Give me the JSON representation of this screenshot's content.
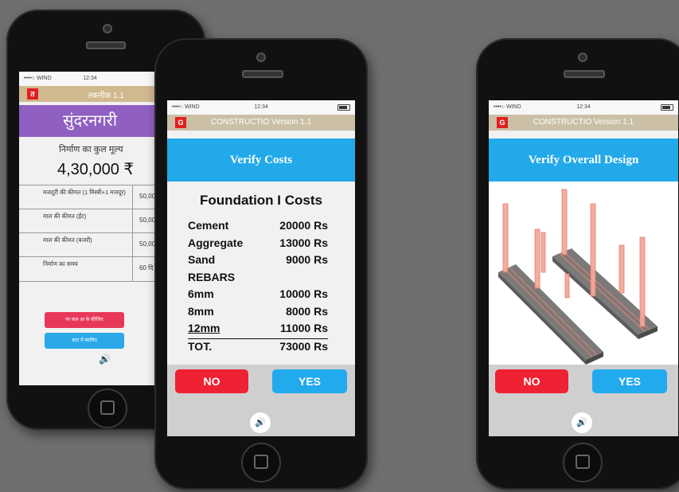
{
  "phone1": {
    "carrier": "••••○ WIND ",
    "time": "12:34",
    "logo_letter": "त",
    "version": "तकनीक 1.1",
    "title": "सुंदरनगरी",
    "total_label": "निर्माण का कुल मूल्य",
    "total_value": "4,30,000 ₹",
    "rows": [
      {
        "label": "मजदूरी की कीमत (1 मिस्त्री+1 मजदूर)",
        "value": "50,00"
      },
      {
        "label": "माल की कीमत (ईंट)",
        "value": "50,00"
      },
      {
        "label": "माल की कीमत (बजरी)",
        "value": "50,00"
      },
      {
        "label": "निर्माण का समय",
        "value": "60 दि"
      }
    ],
    "button1": "पर कल आ के कीजिए",
    "button2": "डाटा में बदलिए"
  },
  "phone2": {
    "carrier": "••••○ WIND ",
    "time": "12:34",
    "logo_letter": "G",
    "version": "CONSTRUCTIO Version 1.1",
    "title": "Verify Costs",
    "section_title": "Foundation I Costs",
    "costs": [
      {
        "label": "Cement",
        "value": "20000 Rs"
      },
      {
        "label": "Aggregate",
        "value": "13000 Rs"
      },
      {
        "label": "Sand",
        "value": "9000 Rs"
      },
      {
        "label": "REBARS",
        "value": ""
      },
      {
        "label": "6mm",
        "value": "10000 Rs"
      },
      {
        "label": "8mm",
        "value": "8000 Rs"
      },
      {
        "label": "12mm",
        "value": "11000 Rs"
      },
      {
        "label": "TOT.",
        "value": "73000 Rs"
      }
    ],
    "no_label": "NO",
    "yes_label": "YES"
  },
  "phone3": {
    "carrier": "••••○ WIND ",
    "time": "12:34",
    "logo_letter": "G",
    "version": "CONSTRUCTIO Version 1.1",
    "title": "Verify Overall Design",
    "no_label": "NO",
    "yes_label": "YES"
  },
  "icons": {
    "sound": "speaker-icon",
    "wifi": "wifi-icon",
    "battery": "battery-icon"
  },
  "colors": {
    "background": "#6f6f6f",
    "title_blue": "#22a9ea",
    "no_red": "#ee2233",
    "yes_blue": "#22aaee",
    "appbar_tan": "#cbbfa6",
    "hindi_title_purple": "#8f5fc2"
  }
}
